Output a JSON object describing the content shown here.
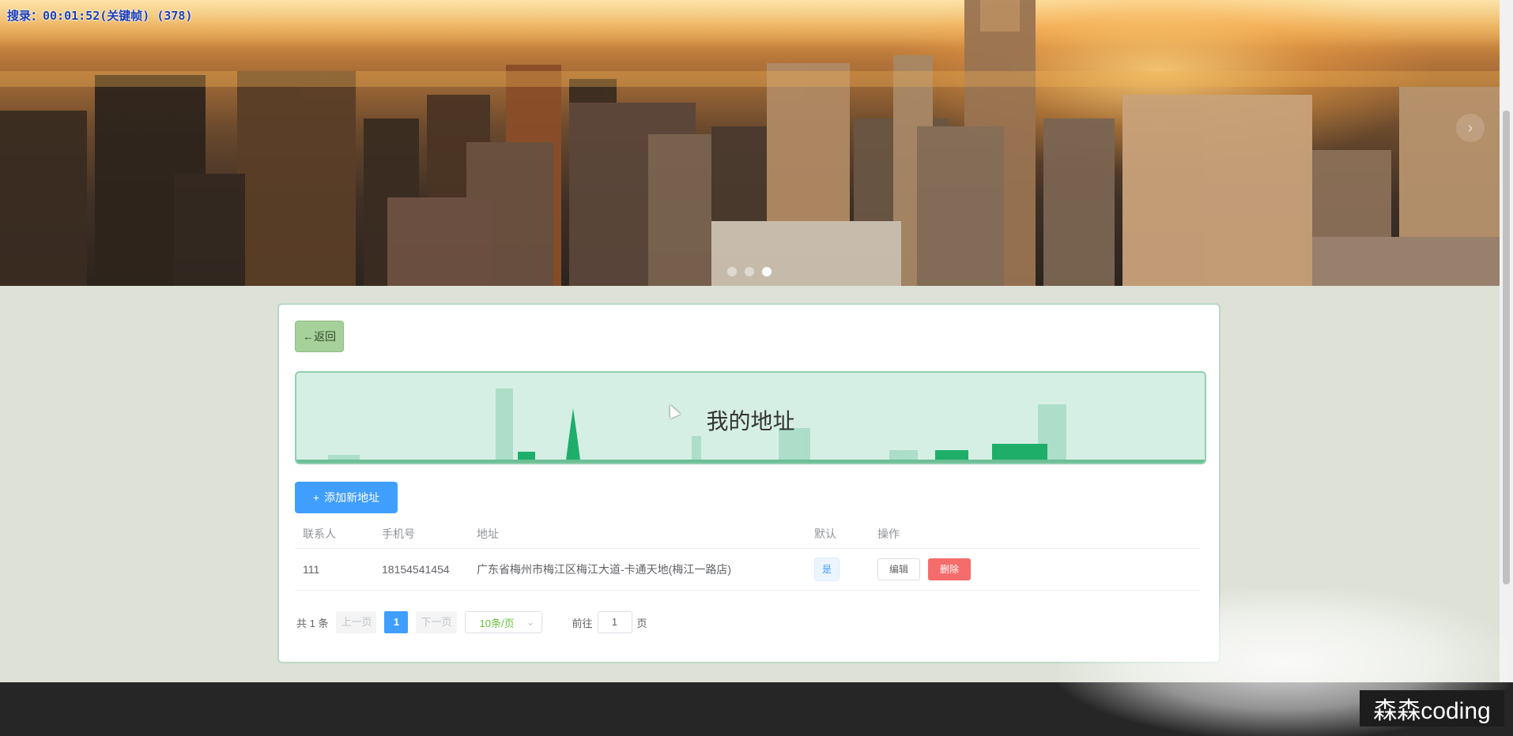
{
  "recording": {
    "text": "搜录：00:01:52(关键帧) (378)"
  },
  "banner": {
    "slides": 3,
    "active_slide": 3,
    "next_arrow": "›"
  },
  "back_button": {
    "label": "←返回"
  },
  "header": {
    "title": "我的地址"
  },
  "add_button": {
    "icon": "+",
    "label": "添加新地址"
  },
  "table": {
    "columns": [
      "联系人",
      "手机号",
      "地址",
      "默认",
      "操作"
    ],
    "rows": [
      {
        "contact": "111",
        "phone": "18154541454",
        "address": "广东省梅州市梅江区梅江大道-卡通天地(梅江一路店)",
        "default": "是",
        "actions": {
          "edit": "编辑",
          "delete": "删除"
        }
      }
    ]
  },
  "pagination": {
    "total": "共 1 条",
    "prev": "上一页",
    "current_page": "1",
    "next": "下一页",
    "page_size": "10条/页",
    "goto_label": "前往",
    "goto_value": "1",
    "page_suffix": "页"
  },
  "watermark": {
    "text": "森森coding"
  },
  "colors": {
    "primary": "#409eff",
    "danger": "#f56c6c",
    "back_button": "#a7d19b",
    "title_box": "#d6efe4",
    "footer": "#262626"
  }
}
